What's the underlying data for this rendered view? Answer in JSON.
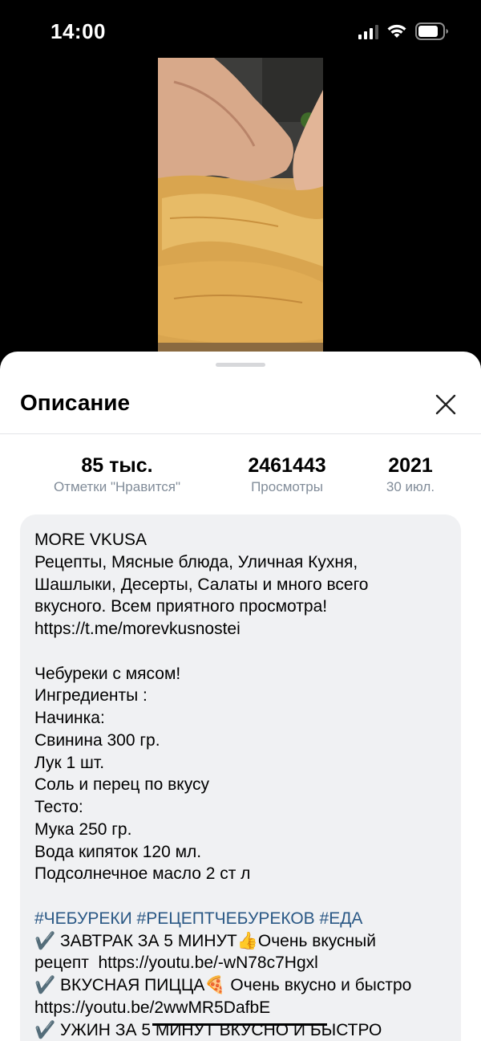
{
  "status_bar": {
    "time": "14:00"
  },
  "sheet": {
    "title": "Описание"
  },
  "stats": {
    "likes_value": "85 тыс.",
    "likes_label": "Отметки \"Нравится\"",
    "views_value": "2461443",
    "views_label": "Просмотры",
    "year_value": "2021",
    "date_label": "30 июл."
  },
  "description": {
    "lines": [
      "MORE VKUSA",
      "Рецепты, Мясные блюда, Уличная Кухня,",
      "Шашлыки, Десерты, Салаты и много всего",
      "вкусного. Всем приятного просмотра!",
      "https://t.me/morevkusnostei",
      "",
      "Чебуреки с мясом!",
      "Ингредиенты :",
      "Начинка:",
      "Свинина 300 гр.",
      "Лук 1 шт.",
      "Соль и перец по вкусу",
      "Тесто:",
      "Мука 250 гр.",
      "Вода кипяток 120 мл.",
      "Подсолнечное масло 2 ст л",
      ""
    ],
    "hashtags": [
      "#ЧЕБУРЕКИ",
      "#РЕЦЕПТЧЕБУРЕКОВ",
      "#ЕДА"
    ],
    "links": [
      "✔️ ЗАВТРАК ЗА 5 МИНУТ👍Очень вкусный",
      "рецепт  https://youtu.be/-wN78c7Hgxl",
      "✔️ ВКУСНАЯ ПИЦЦА🍕 Очень вкусно и быстро",
      "https://youtu.be/2wwMR5DafbE",
      "✔️ УЖИН ЗА 5 МИНУТ ВКУСНО И БЫСТРО"
    ]
  },
  "icons": {
    "signal": "cellular-signal-icon",
    "wifi": "wifi-icon",
    "battery": "battery-icon",
    "close": "close-icon",
    "checkmark": "checkmark-icon"
  },
  "colors": {
    "hashtag": "#2a5885",
    "secondary_text": "#818c99",
    "description_bg": "#f0f1f3"
  }
}
